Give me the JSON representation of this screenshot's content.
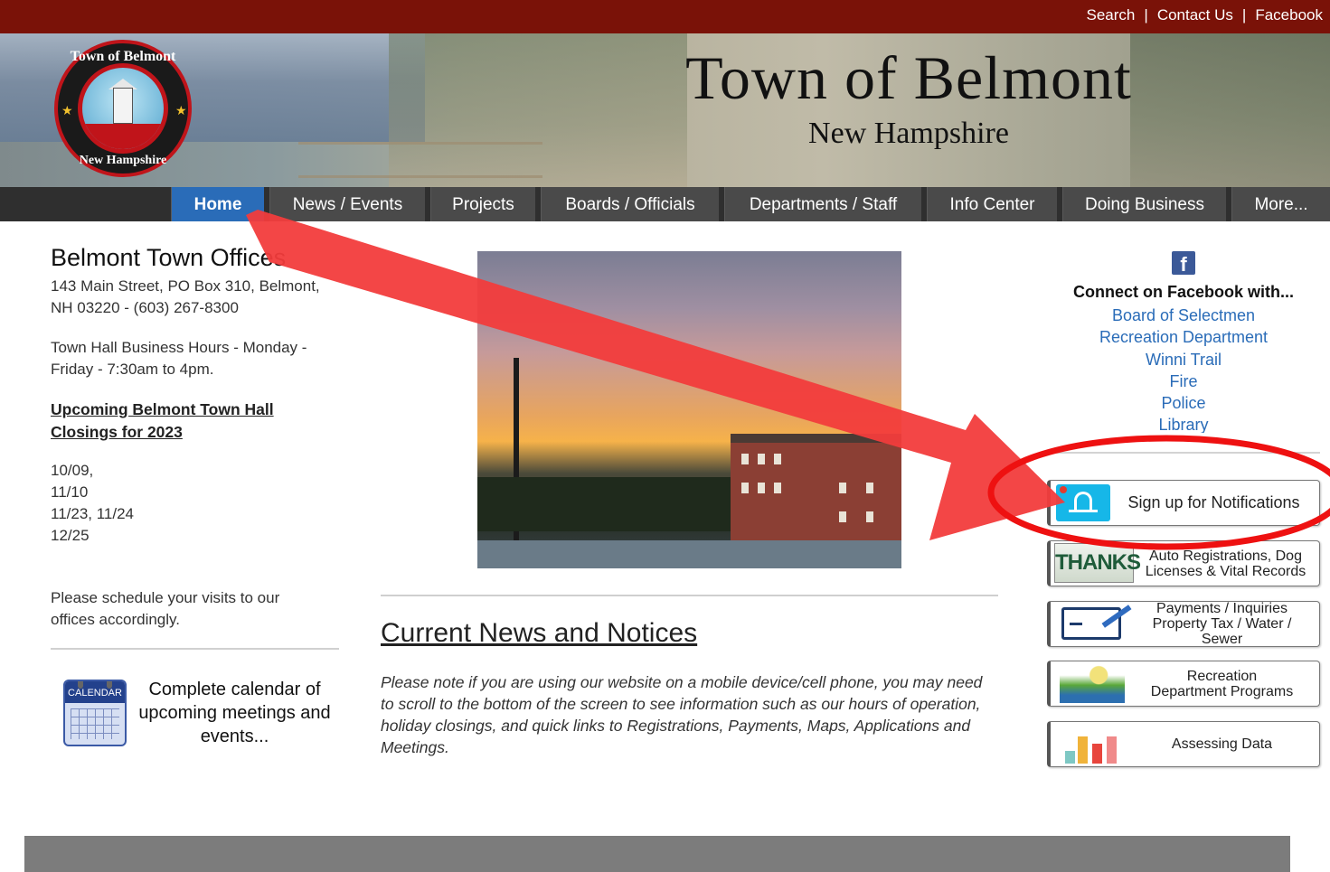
{
  "topbar": {
    "links": [
      "Search",
      "Contact Us",
      "Facebook"
    ],
    "separator": "|"
  },
  "header": {
    "title": "Town of Belmont",
    "subtitle": "New Hampshire",
    "seal_top": "Town of Belmont",
    "seal_bottom": "New Hampshire"
  },
  "nav": {
    "items": [
      {
        "label": "Home",
        "active": true
      },
      {
        "label": "News / Events"
      },
      {
        "label": "Projects"
      },
      {
        "label": "Boards / Officials"
      },
      {
        "label": "Departments / Staff"
      },
      {
        "label": "Info Center"
      },
      {
        "label": "Doing Business"
      },
      {
        "label": "More..."
      }
    ]
  },
  "left": {
    "office_title": "Belmont Town Offices",
    "address": "143 Main Street, PO Box 310, Belmont, NH 03220 - (603) 267-8300",
    "hours": "Town Hall Business Hours - Monday - Friday - 7:30am  to 4pm.",
    "closings_link": "Upcoming Belmont Town Hall Closings for 2023",
    "closing_dates": [
      "10/09,",
      "11/10",
      "11/23, 11/24",
      "12/25"
    ],
    "schedule_note": "Please schedule your visits to our offices accordingly.",
    "calendar_icon_label": "CALENDAR",
    "calendar_text": "Complete calendar of upcoming meetings and events..."
  },
  "center": {
    "news_title": "Current News and Notices",
    "news_note": "Please note if you are using our website on a mobile device/cell phone, you may need to scroll to the bottom of the screen to see information such as our hours of operation, holiday closings, and quick links to Registrations, Payments, Maps, Applications and Meetings."
  },
  "right": {
    "fb_icon": "facebook-icon",
    "fb_heading": "Connect on Facebook with...",
    "fb_links": [
      "Board of Selectmen",
      "Recreation Department",
      "Winni Trail",
      "Fire",
      "Police",
      "Library"
    ],
    "quick_links": [
      {
        "label": "Sign up for Notifications",
        "icon": "bell-icon"
      },
      {
        "label": "Auto Registrations, Dog\nLicenses & Vital Records",
        "icon": "license-plate-icon",
        "plate_text": "THANKS"
      },
      {
        "label": "Payments / Inquiries\nProperty Tax / Water / Sewer",
        "icon": "check-payment-icon"
      },
      {
        "label": "Recreation\nDepartment Programs",
        "icon": "recreation-icon"
      },
      {
        "label": "Assessing Data",
        "icon": "bar-chart-icon"
      }
    ]
  },
  "colors": {
    "topbar": "#7a1208",
    "nav_active": "#2a6cb8",
    "link": "#2a6cb8",
    "annotation": "#f23c3c"
  }
}
